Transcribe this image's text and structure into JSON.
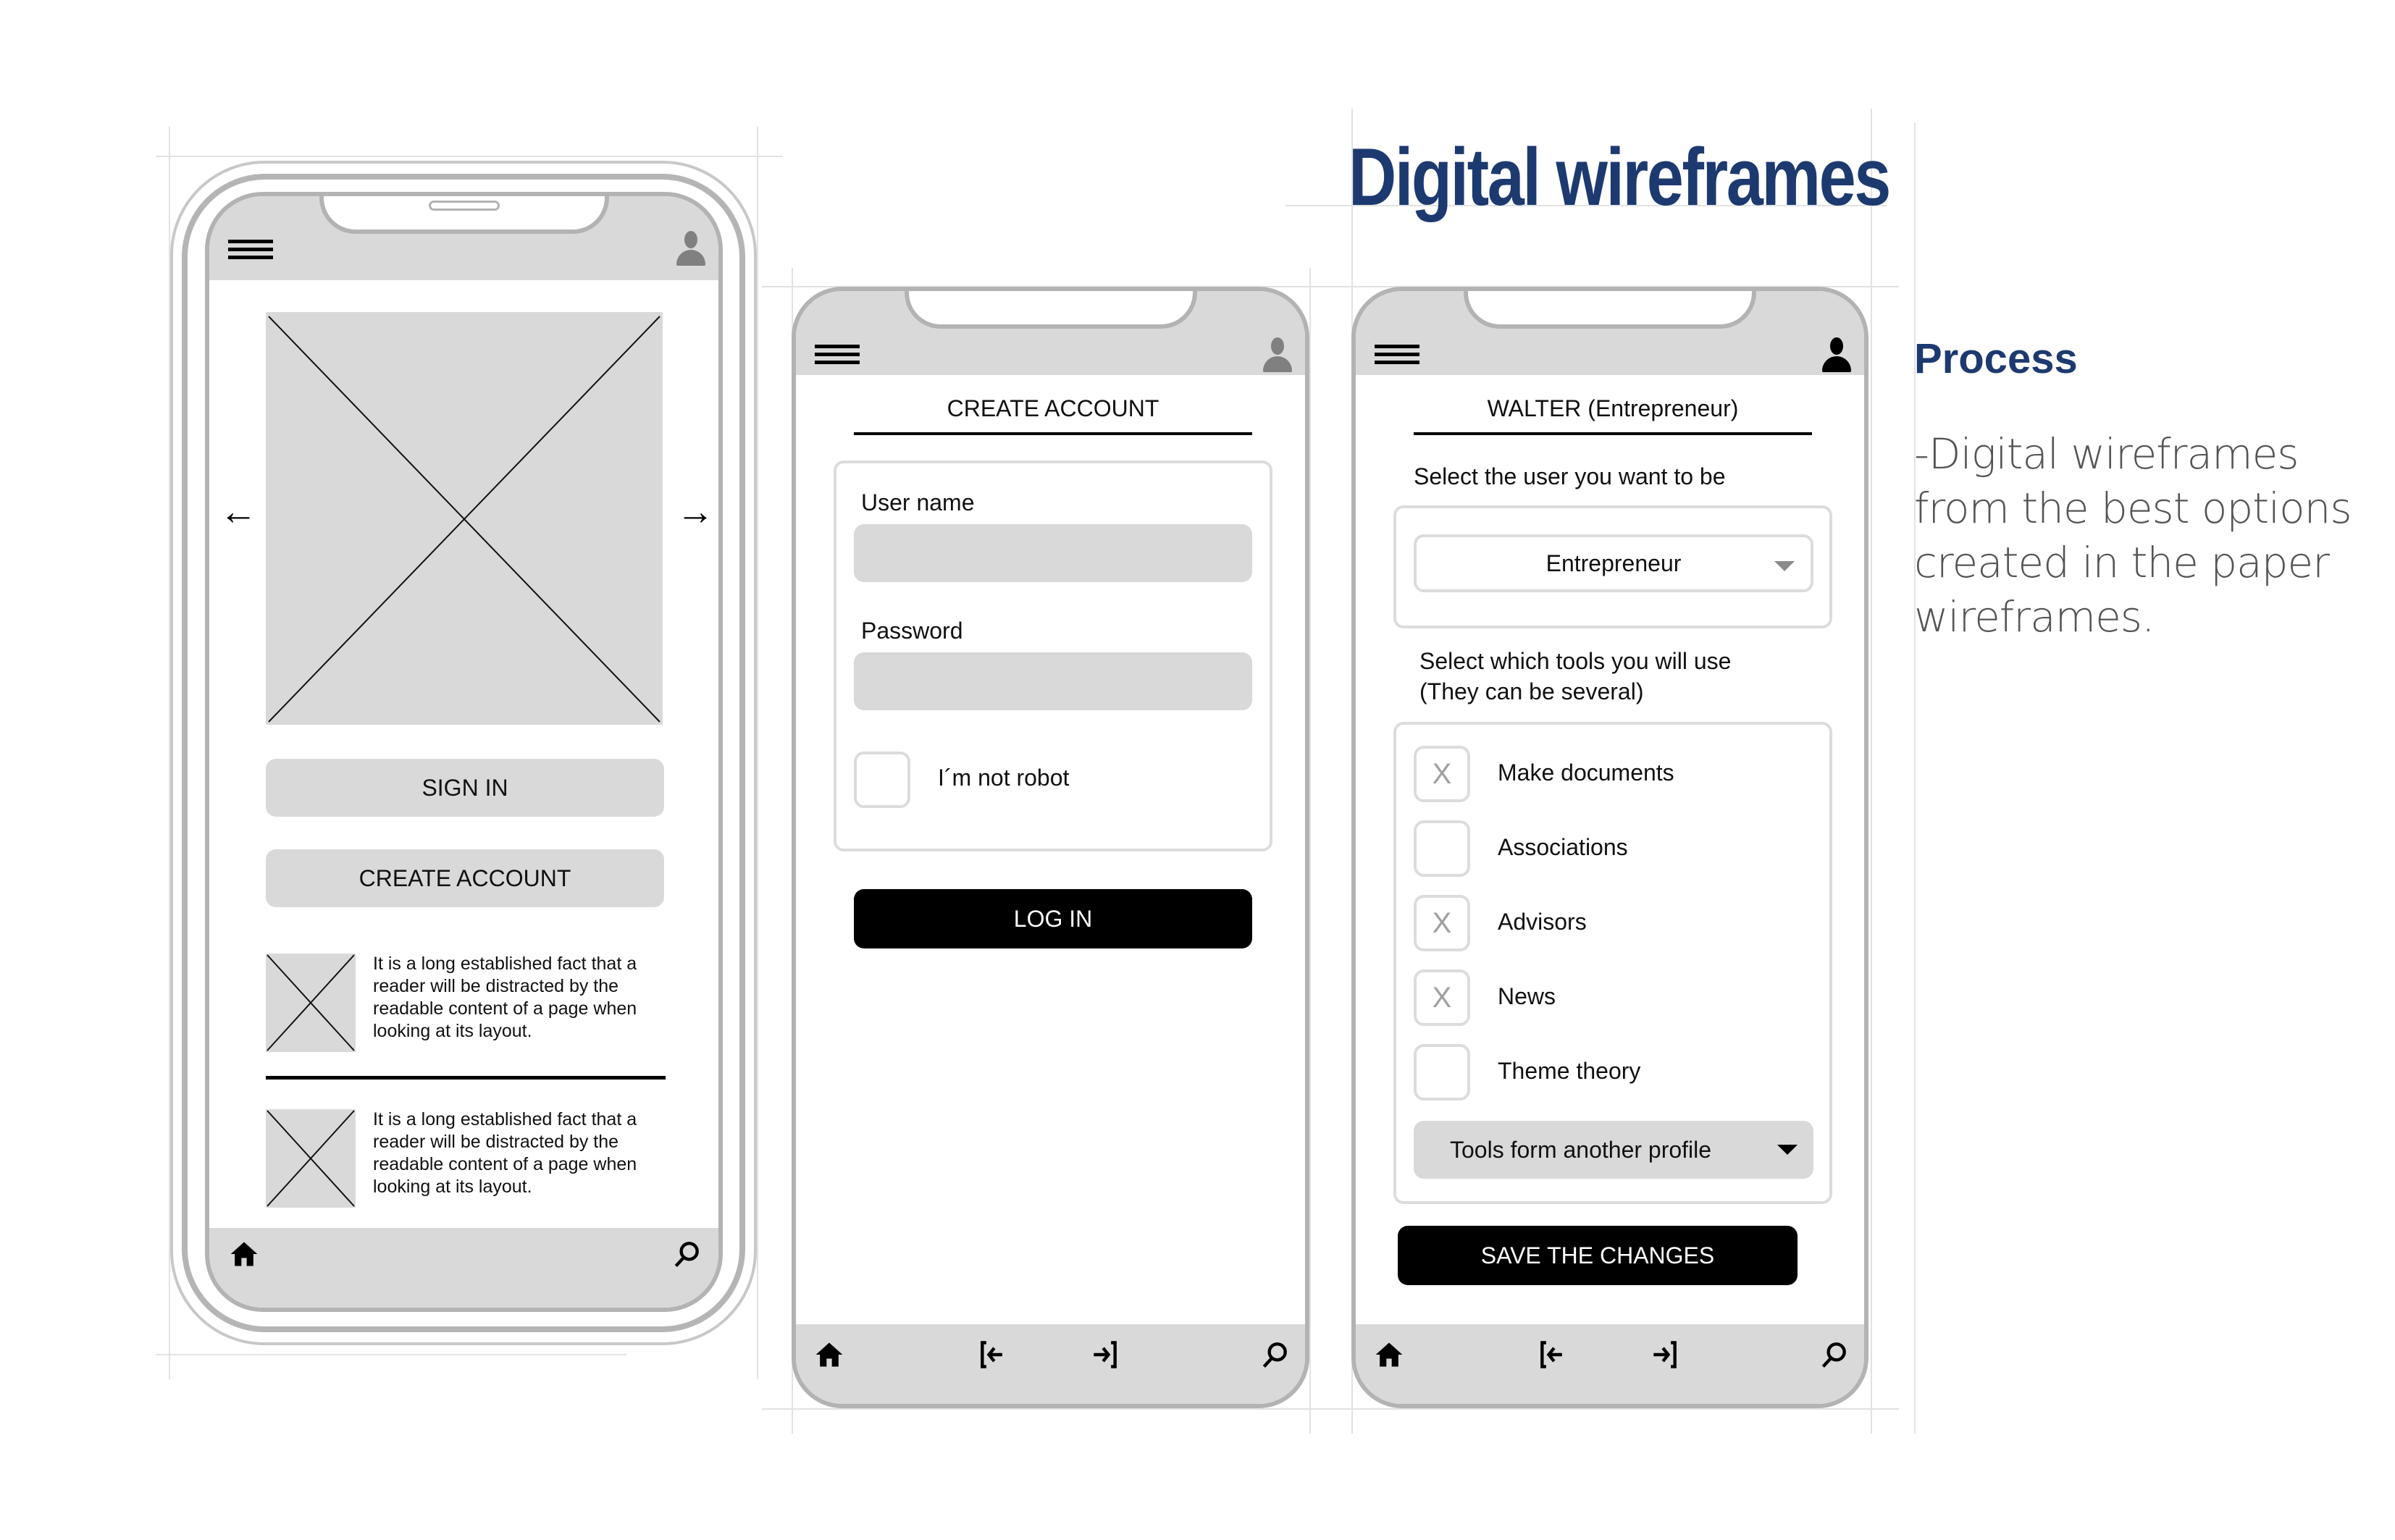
{
  "page": {
    "title": "Digital wireframes",
    "process_title": "Process",
    "process_text": "-Digital wireframes from the best options created in the paper wireframes."
  },
  "colors": {
    "accent_navy": "#1d3a70",
    "body_grey": "#555555",
    "wire_grey": "#d9d9d9",
    "frame_grey": "#b3b3b3",
    "button_black": "#000000"
  },
  "phone1": {
    "top_bar_icons": [
      "hamburger-menu-icon",
      "user-icon"
    ],
    "carousel_icons": [
      "arrow-left-icon",
      "arrow-right-icon"
    ],
    "sign_in_label": "SIGN IN",
    "create_account_label": "CREATE ACCOUNT",
    "cards": [
      {
        "text": "It is a long established fact that a reader will be distracted by the readable content of a page when looking at its layout."
      },
      {
        "text": "It is a long established fact that a reader will be distracted by the readable content of a page when looking at its layout."
      }
    ],
    "bottom_bar_icons": [
      "home-icon",
      "search-icon"
    ]
  },
  "phone2": {
    "heading": "CREATE ACCOUNT",
    "username_label": "User name",
    "username_value": "",
    "password_label": "Password",
    "password_value": "",
    "captcha_label": "I´m not robot",
    "captcha_checked": false,
    "login_label": "LOG IN",
    "bottom_bar_icons": [
      "home-icon",
      "logout-icon",
      "login-icon",
      "search-icon"
    ]
  },
  "phone3": {
    "heading": "WALTER (Entrepreneur)",
    "select_user_label": "Select the user you want to be",
    "selected_user": "Entrepreneur",
    "tools_label_line1": "Select which tools you will use",
    "tools_label_line2": "(They can be several)",
    "tools": [
      {
        "label": "Make documents",
        "checked": true,
        "mark": "X"
      },
      {
        "label": "Associations",
        "checked": false,
        "mark": ""
      },
      {
        "label": "Advisors",
        "checked": true,
        "mark": "X"
      },
      {
        "label": "News",
        "checked": true,
        "mark": "X"
      },
      {
        "label": "Theme theory",
        "checked": false,
        "mark": ""
      }
    ],
    "other_profile_label": "Tools form another profile",
    "save_label": "SAVE THE CHANGES",
    "bottom_bar_icons": [
      "home-icon",
      "logout-icon",
      "login-icon",
      "search-icon"
    ]
  }
}
